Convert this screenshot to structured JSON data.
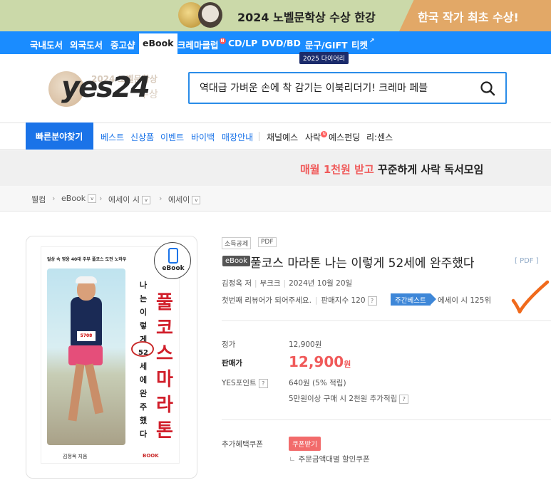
{
  "banner": {
    "left_text": "2024 노벨문학상 수상 한강",
    "right_text": "한국 작가 최초 수상!",
    "colors": {
      "left_bg": "#cbd9a9",
      "right_bg": "#e2a867"
    }
  },
  "category_nav": {
    "items": [
      "국내도서",
      "외국도서",
      "중고샵",
      "eBook",
      "크레마클럽",
      "CD/LP",
      "DVD/BD",
      "문구/GIFT",
      "티켓"
    ],
    "active": "eBook",
    "diary_tag": "2025 다이어리",
    "new_badge": "N"
  },
  "logo": {
    "text": "yes24",
    "ghost_line1": "2024 노벨문학상",
    "ghost_line2": "수상"
  },
  "search": {
    "placeholder": "역대급 가벼운 손에 착 감기는 이북리더기! 크레마 페블",
    "icon": "search-icon"
  },
  "sub_nav": {
    "quick": "빠른분야찾기",
    "links": [
      "베스트",
      "신상품",
      "이벤트",
      "바이백",
      "매장안내"
    ],
    "dark_links": [
      "채널예스",
      "사락",
      "예스펀딩",
      "리:센스"
    ],
    "new_badge": "N"
  },
  "promo": {
    "accent": "매월 1천원 받고",
    "rest": " 꾸준하게 사락 독서모임"
  },
  "breadcrumb": {
    "items": [
      "웰컴",
      "eBook",
      "에세이 시",
      "에세이"
    ],
    "dropdown": "v"
  },
  "cover": {
    "top_line": "일상 속 영웅 40대 주부 풀코스 도전 노하우",
    "vertical_text": "나는이렇게52세에완주했다",
    "vertical_chars": [
      "나",
      "는",
      "이",
      "렇",
      "게",
      "52",
      "세",
      "에",
      "완",
      "주",
      "했",
      "다"
    ],
    "title_chars": [
      "풀",
      "코",
      "스",
      "마",
      "라",
      "톤"
    ],
    "author": "김정옥 지음",
    "publisher": "BOOK",
    "bib": "5708",
    "ebook_badge": "eBook"
  },
  "product": {
    "tags": [
      "소득공제",
      "PDF"
    ],
    "ebook_label": "eBook",
    "title": "풀코스 마라톤 나는 이렇게 52세에 완주했다",
    "format_suffix": "[ PDF ]",
    "author": "김정옥 저",
    "publisher": "부크크",
    "date": "2024년 10월 20일",
    "review_cta": "첫번째 리뷰어가 되어주세요.",
    "sales_index": "판매지수 120",
    "weekly_best": "주간베스트",
    "rank": "에세이 시 125위",
    "qmark": "?"
  },
  "pricing": {
    "list_label": "정가",
    "list_price": "12,900원",
    "sale_label": "판매가",
    "sale_price": "12,900",
    "sale_unit": "원",
    "points_label": "YES포인트",
    "points_value": "640원 (5% 적립)",
    "points_extra": "5만원이상 구매 시 2천원 추가적립",
    "coupon_label": "추가혜택쿠폰",
    "coupon_button": "쿠폰받기",
    "coupon_desc": "주문금액대별 할인쿠폰",
    "coupon_bullet": "ㄴ"
  }
}
